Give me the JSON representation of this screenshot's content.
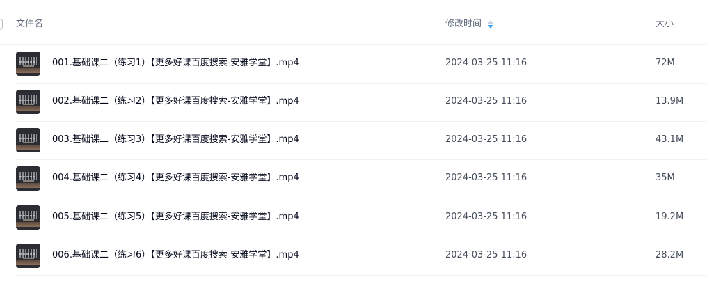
{
  "header": {
    "name_label": "文件名",
    "time_label": "修改时间",
    "size_label": "大小"
  },
  "files": [
    {
      "name": "001.基础课二（练习1）【更多好课百度搜索-安雅学堂】.mp4",
      "modified": "2024-03-25 11:16",
      "size": "72M"
    },
    {
      "name": "002.基础课二（练习2）【更多好课百度搜索-安雅学堂】.mp4",
      "modified": "2024-03-25 11:16",
      "size": "13.9M"
    },
    {
      "name": "003.基础课二（练习3）【更多好课百度搜索-安雅学堂】.mp4",
      "modified": "2024-03-25 11:16",
      "size": "43.1M"
    },
    {
      "name": "004.基础课二（练习4）【更多好课百度搜索-安雅学堂】.mp4",
      "modified": "2024-03-25 11:16",
      "size": "35M"
    },
    {
      "name": "005.基础课二（练习5）【更多好课百度搜索-安雅学堂】.mp4",
      "modified": "2024-03-25 11:16",
      "size": "19.2M"
    },
    {
      "name": "006.基础课二（练习6）【更多好课百度搜索-安雅学堂】.mp4",
      "modified": "2024-03-25 11:16",
      "size": "28.2M"
    }
  ],
  "colors": {
    "sort_active": "#3ea6f5",
    "text_primary": "#03081a",
    "text_secondary": "#454d5a",
    "header_text": "#616a7d"
  }
}
